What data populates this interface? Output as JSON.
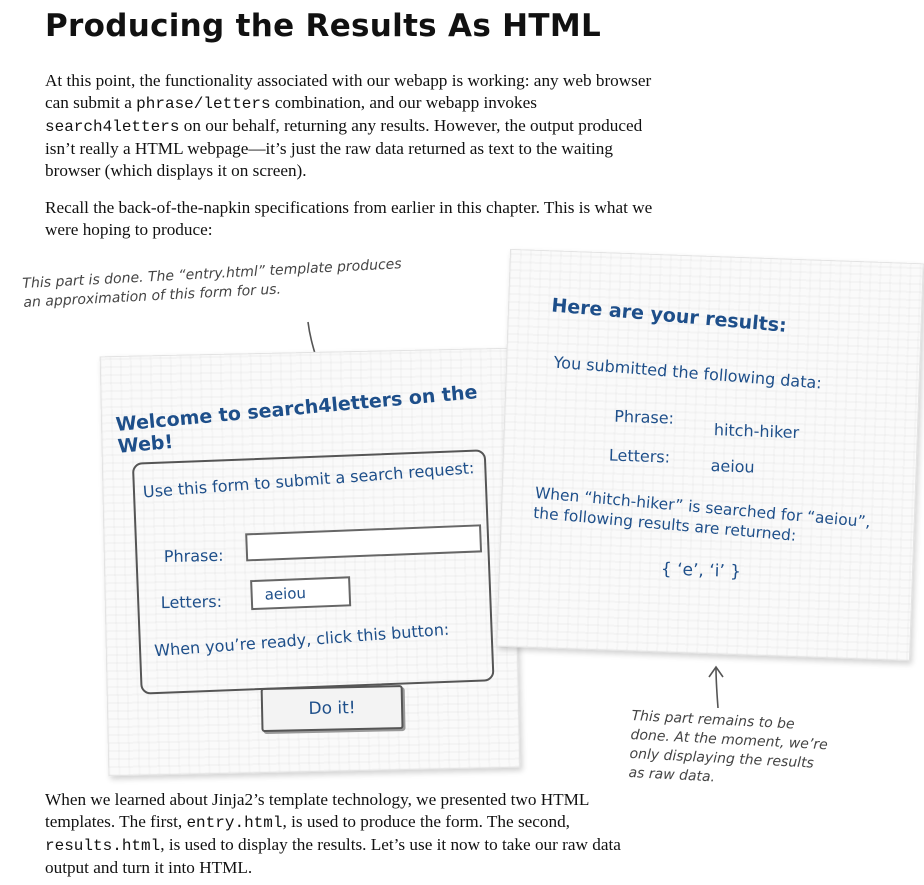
{
  "title": "Producing the Results As HTML",
  "para1": {
    "t1": "At this point, the functionality associated with our webapp is working: any web browser can submit a ",
    "c1": "phrase/letters",
    "t2": " combination, and our webapp invokes ",
    "c2": "search4letters",
    "t3": " on our behalf, returning any results. However, the output produced isn’t really a HTML webpage—it’s just the raw data returned as text to the waiting browser (which displays it on screen)."
  },
  "para2": "Recall the back-of-the-napkin specifications from earlier in this chapter. This is what we were hoping to produce:",
  "annot_left": "This part is done. The “entry.html” template produces an approximation of this form for us.",
  "annot_right": "This part remains to be done. At the moment, we’re only displaying the results as raw data.",
  "entry_napkin": {
    "title": "Welcome to search4letters on the Web!",
    "form_intro": "Use this form to submit a search request:",
    "phrase_label": "Phrase:",
    "phrase_value": "",
    "letters_label": "Letters:",
    "letters_value": "aeiou",
    "ready_text": "When you’re ready, click this button:",
    "button_label": "Do it!"
  },
  "results_napkin": {
    "title": "Here are your results:",
    "submitted": "You submitted the following data:",
    "phrase_label": "Phrase:",
    "phrase_value": "hitch-hiker",
    "letters_label": "Letters:",
    "letters_value": "aeiou",
    "when_text": "When “hitch-hiker” is searched for “aeiou”, the following results are returned:",
    "result": "{ ‘e’, ‘i’ }"
  },
  "para3": {
    "t1": "When we learned about Jinja2’s template technology, we presented two HTML templates. The first, ",
    "c1": "entry.html",
    "t2": ", is used to produce the form. The second, ",
    "c2": "results.html",
    "t3": ", is used to display the results. Let’s use it now to take our raw data output and turn it into HTML."
  }
}
